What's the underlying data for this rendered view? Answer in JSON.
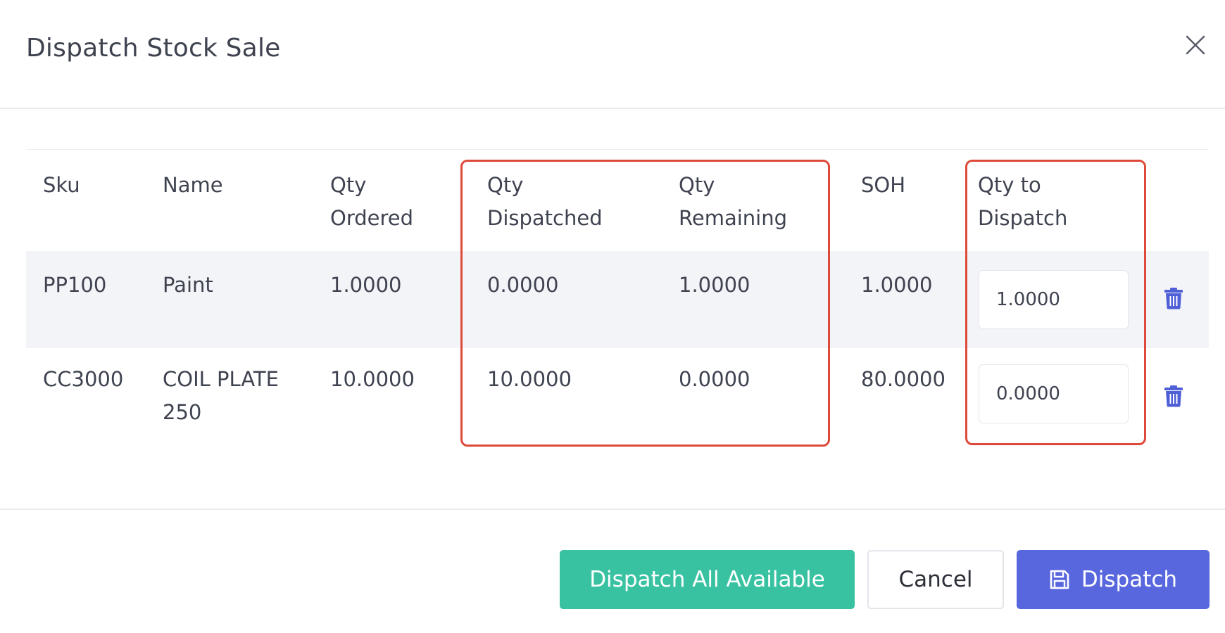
{
  "modal": {
    "title": "Dispatch Stock Sale",
    "close_icon": "close-icon"
  },
  "table": {
    "headers": {
      "sku": "Sku",
      "name": "Name",
      "qty_ordered": "Qty\nOrdered",
      "qty_dispatched": "Qty\nDispatched",
      "qty_remaining": "Qty\nRemaining",
      "soh": "SOH",
      "qty_to_dispatch": "Qty to\nDispatch"
    },
    "rows": [
      {
        "sku": "PP100",
        "name": "Paint",
        "qty_ordered": "1.0000",
        "qty_dispatched": "0.0000",
        "qty_remaining": "1.0000",
        "soh": "1.0000",
        "qty_to_dispatch": "1.0000",
        "delete_icon": "trash-icon"
      },
      {
        "sku": "CC3000",
        "name": "COIL PLATE\n250",
        "qty_ordered": "10.0000",
        "qty_dispatched": "10.0000",
        "qty_remaining": "0.0000",
        "soh": "80.0000",
        "qty_to_dispatch": "0.0000",
        "delete_icon": "trash-icon"
      }
    ]
  },
  "footer": {
    "dispatch_all_label": "Dispatch All Available",
    "cancel_label": "Cancel",
    "dispatch_label": "Dispatch",
    "dispatch_icon": "save-icon"
  },
  "colors": {
    "highlight": "#de4a3a",
    "green": "#38c2a1",
    "primary": "#5867dd",
    "row_stripe": "#f3f4f8"
  }
}
